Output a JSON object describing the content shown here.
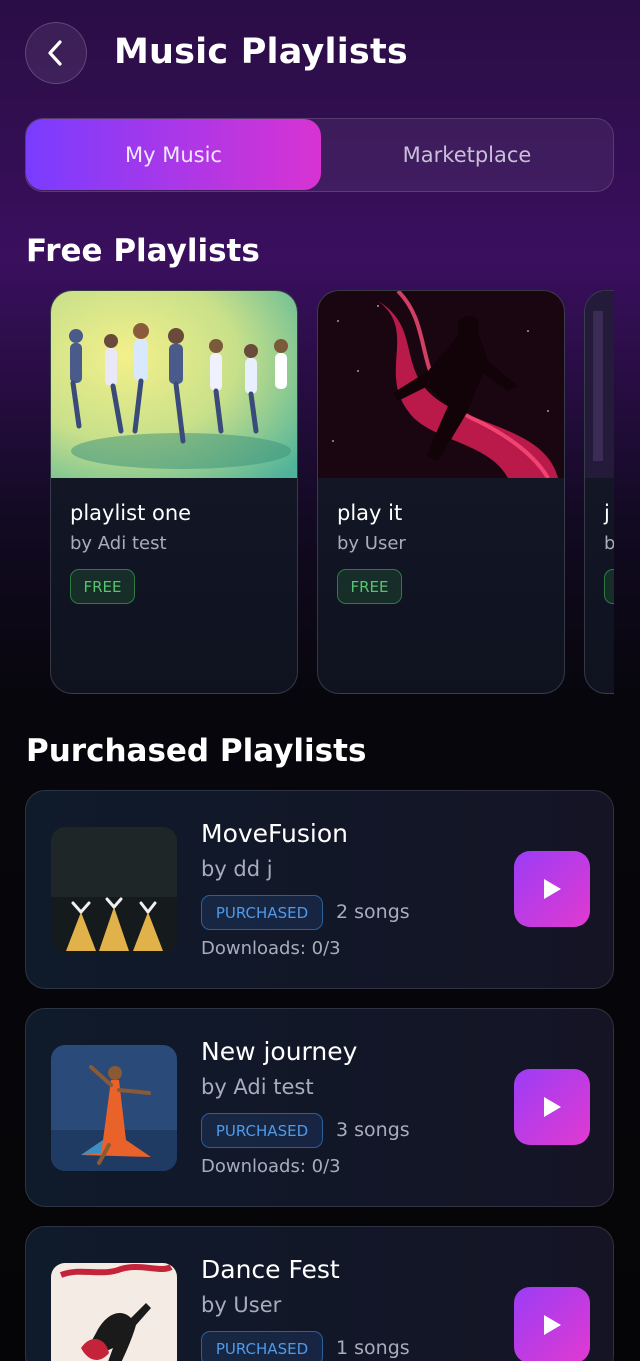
{
  "header": {
    "title": "Music Playlists",
    "back_icon": "chevron-left-icon"
  },
  "tabs": {
    "my_music": "My Music",
    "marketplace": "Marketplace",
    "active": "My Music"
  },
  "free_section": {
    "title": "Free Playlists",
    "cards": [
      {
        "title": "playlist one",
        "author": "by Adi test",
        "badge": "FREE"
      },
      {
        "title": "play it",
        "author": "by User",
        "badge": "FREE"
      },
      {
        "title": "j",
        "author": "b",
        "badge": ""
      }
    ]
  },
  "purchased_section": {
    "title": "Purchased Playlists",
    "items": [
      {
        "title": "MoveFusion",
        "author": "by dd j",
        "badge": "PURCHASED",
        "songs": "2 songs",
        "downloads": "Downloads: 0/3"
      },
      {
        "title": "New journey",
        "author": "by Adi test",
        "badge": "PURCHASED",
        "songs": "3 songs",
        "downloads": "Downloads: 0/3"
      },
      {
        "title": "Dance Fest",
        "author": "by User",
        "badge": "PURCHASED",
        "songs": "1 songs",
        "downloads": ""
      }
    ]
  },
  "colors": {
    "accent_start": "#7a3cff",
    "accent_end": "#d833d2",
    "free": "#56c46e",
    "purchased": "#4f9ae8"
  }
}
